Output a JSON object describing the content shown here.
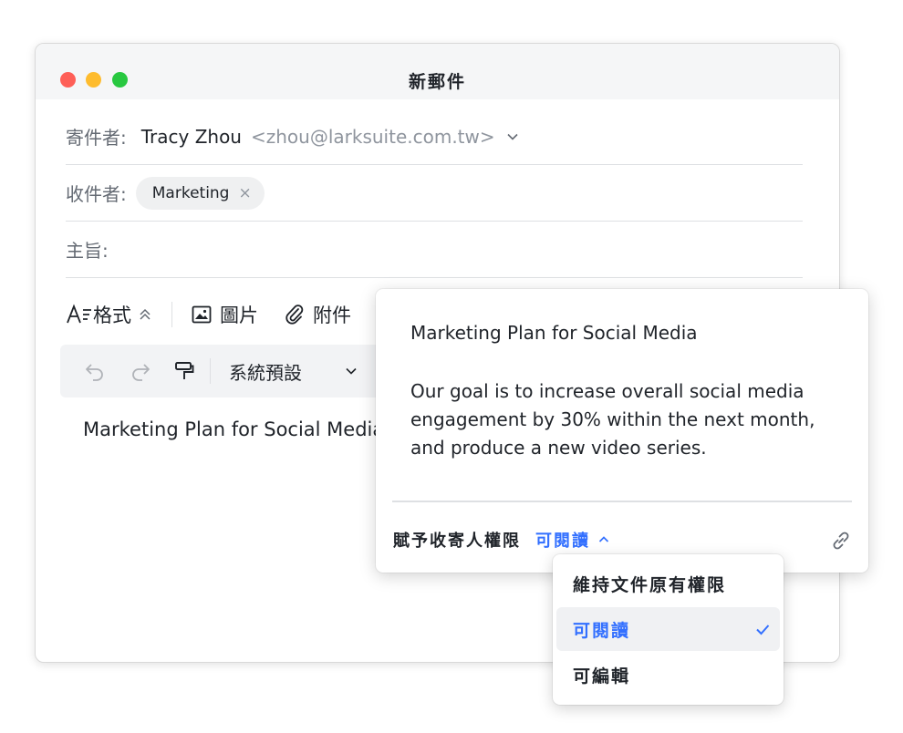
{
  "window": {
    "title": "新郵件"
  },
  "sender": {
    "label": "寄件者:",
    "name": "Tracy Zhou",
    "email": "<zhou@larksuite.com.tw>"
  },
  "recipient": {
    "label": "收件者:",
    "chip": "Marketing"
  },
  "subject": {
    "label": "主旨:"
  },
  "format_bar": {
    "format_label": "格式",
    "image_label": "圖片",
    "attach_label": "附件"
  },
  "toolbar": {
    "font_style": "系統預設"
  },
  "body": {
    "doc_link": "Marketing Plan for Social Media"
  },
  "popover": {
    "title": "Marketing Plan for Social Media",
    "text": "Our goal is to increase overall social media engagement by 30% within the next month, and produce a new video series.",
    "permission_label": "賦予收寄人權限",
    "permission_value": "可閱讀"
  },
  "dropdown": {
    "options": [
      "維持文件原有權限",
      "可閱讀",
      "可編輯"
    ],
    "selected_index": 1
  },
  "colors": {
    "accent": "#3370ff",
    "close": "#fe5f57",
    "minimize": "#febc2e",
    "zoom": "#28c840"
  }
}
